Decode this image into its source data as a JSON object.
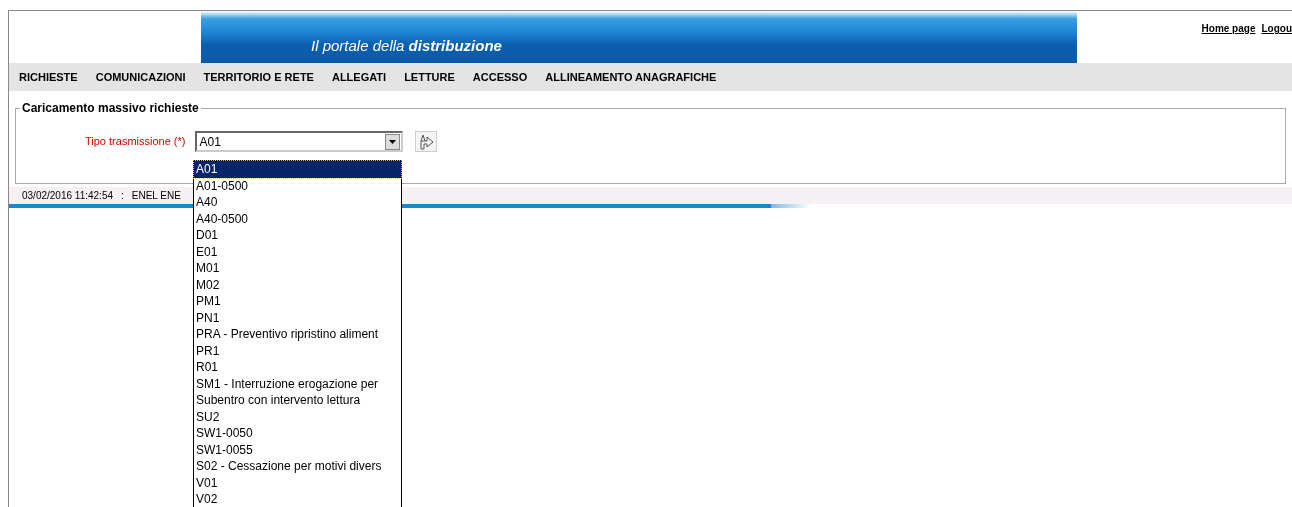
{
  "header": {
    "tagline_prefix": "Il portale della ",
    "tagline_emphasis": "distribuzione",
    "links": [
      "Home page",
      "Logou"
    ]
  },
  "menu": [
    "RICHIESTE",
    "COMUNICAZIONI",
    "TERRITORIO E RETE",
    "ALLEGATI",
    "LETTURE",
    "ACCESSO",
    "ALLINEAMENTO ANAGRAFICHE"
  ],
  "form": {
    "legend": "Caricamento massivo richieste",
    "label": "Tipo trasmissione (*)",
    "value": "A01",
    "expanded": true
  },
  "options": [
    {
      "label": "A01",
      "selected": true
    },
    {
      "label": "A01-0500",
      "selected": false
    },
    {
      "label": "A40",
      "selected": false
    },
    {
      "label": "A40-0500",
      "selected": false
    },
    {
      "label": "D01",
      "selected": false
    },
    {
      "label": "E01",
      "selected": false
    },
    {
      "label": "M01",
      "selected": false
    },
    {
      "label": "M02",
      "selected": false
    },
    {
      "label": "PM1",
      "selected": false
    },
    {
      "label": "PN1",
      "selected": false
    },
    {
      "label": "PRA - Preventivo ripristino aliment",
      "selected": false
    },
    {
      "label": "PR1",
      "selected": false
    },
    {
      "label": "R01",
      "selected": false
    },
    {
      "label": "SM1 - Interruzione erogazione per",
      "selected": false
    },
    {
      "label": "Subentro con intervento lettura",
      "selected": false
    },
    {
      "label": "SU2",
      "selected": false
    },
    {
      "label": "SW1-0050",
      "selected": false
    },
    {
      "label": "SW1-0055",
      "selected": false
    },
    {
      "label": "S02 - Cessazione per motivi divers",
      "selected": false
    },
    {
      "label": "V01",
      "selected": false
    },
    {
      "label": "V02",
      "selected": false
    }
  ],
  "status_bar": {
    "timestamp": "03/02/2016 11:42:54",
    "separator": ":",
    "user": "ENEL ENE"
  }
}
